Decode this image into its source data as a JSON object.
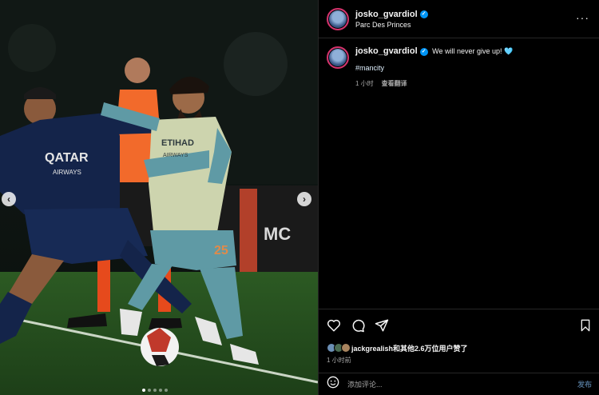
{
  "media": {
    "prev_arrow": "‹",
    "next_arrow": "›",
    "slide_count": 5,
    "active_slide": 1
  },
  "post": {
    "username": "josko_gvardiol",
    "location": "Parc Des Princes",
    "verified_symbol": "✓",
    "more_symbol": "···",
    "caption_text": "We will never give up! ",
    "caption_emoji": "🩵",
    "hashtag": "#mancity",
    "time_ago": "1 小时",
    "translate_label": "查看翻译"
  },
  "likes": {
    "prefix_user": "jackgrealish",
    "suffix": "和其他2.6万位用户赞了",
    "time": "1 小时前"
  },
  "comment": {
    "emoji_icon": "smiley-icon",
    "placeholder": "添加评论...",
    "post_label": "发布"
  },
  "colors": {
    "verified": "#0095f6",
    "story_ring": "#d6336c",
    "psg_navy": "#14244a",
    "city_teal": "#5f9aa5",
    "referee_orange": "#f26a2b"
  }
}
